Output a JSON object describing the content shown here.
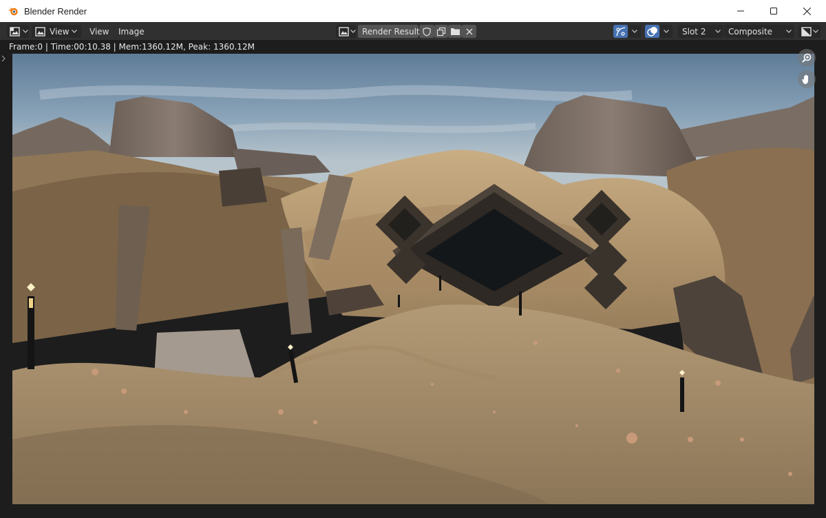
{
  "window": {
    "title": "Blender Render",
    "icon": "blender-logo-icon"
  },
  "header": {
    "editor_type_icon": "image-editor-icon",
    "view_mode_label": "View",
    "menu_view": "View",
    "menu_image": "Image",
    "image_browse_icon": "image-browse-icon",
    "image_name": "Render Result",
    "slot": "Slot 2",
    "layer": "Composite",
    "accent_color": "#4772b3"
  },
  "status": {
    "frame": "Frame:0",
    "time": "Time:00:10.38",
    "mem": "Mem:1360.12M, Peak: 1360.12M"
  }
}
